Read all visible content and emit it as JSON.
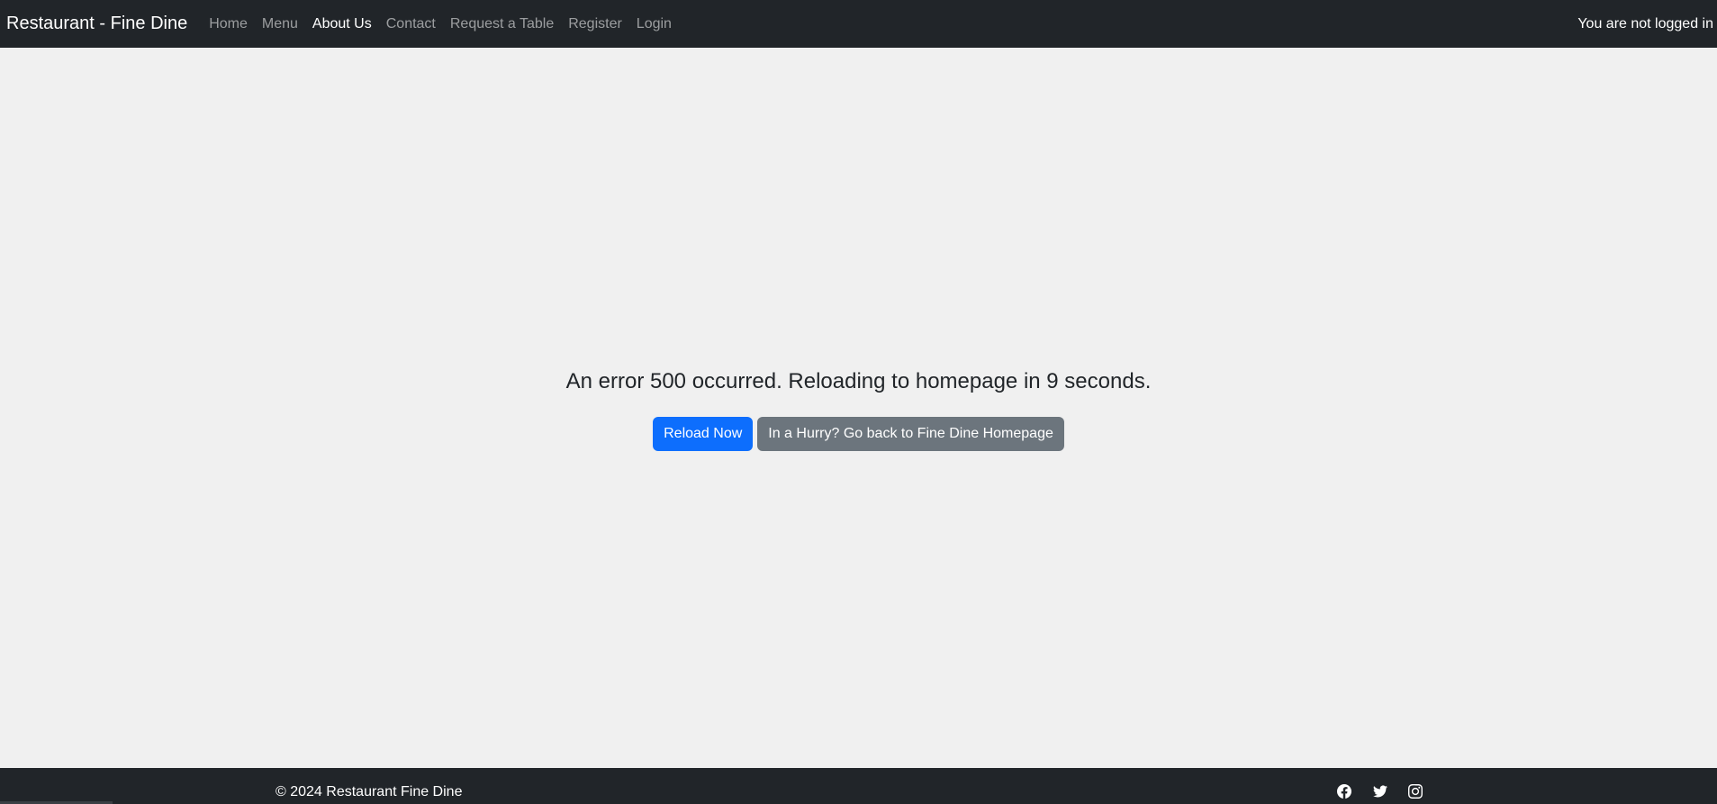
{
  "navbar": {
    "brand": "Restaurant - Fine Dine",
    "links": [
      {
        "label": "Home",
        "active": false
      },
      {
        "label": "Menu",
        "active": false
      },
      {
        "label": "About Us",
        "active": true
      },
      {
        "label": "Contact",
        "active": false
      },
      {
        "label": "Request a Table",
        "active": false
      },
      {
        "label": "Register",
        "active": false
      },
      {
        "label": "Login",
        "active": false
      }
    ],
    "login_status": "You are not logged in"
  },
  "main": {
    "error_message": "An error 500 occurred. Reloading to homepage in 9 seconds.",
    "reload_button": "Reload Now",
    "home_button": "In a Hurry? Go back to Fine Dine Homepage"
  },
  "footer": {
    "copyright": "© 2024 Restaurant Fine Dine",
    "social_icons": [
      "facebook-icon",
      "twitter-icon",
      "instagram-icon"
    ]
  },
  "colors": {
    "navbar_bg": "#212529",
    "page_bg": "#f0f0f0",
    "primary": "#0d6efd",
    "secondary": "#6c757d"
  }
}
